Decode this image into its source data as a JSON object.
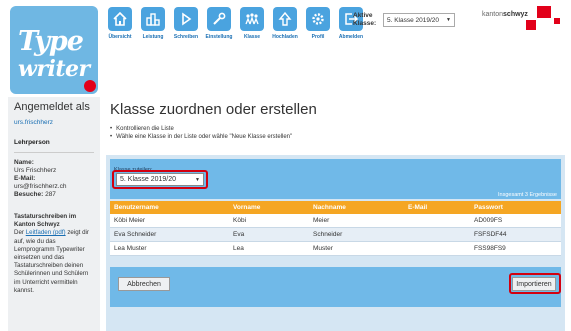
{
  "logo": {
    "line1": "Type",
    "line2": "writer"
  },
  "nav": [
    {
      "label": "Übersicht",
      "icon": "home-icon"
    },
    {
      "label": "Leistung",
      "icon": "chart-icon"
    },
    {
      "label": "Schreiben",
      "icon": "play-icon"
    },
    {
      "label": "Einstellung",
      "icon": "wrench-icon"
    },
    {
      "label": "Klasse",
      "icon": "group-icon"
    },
    {
      "label": "Hochladen",
      "icon": "upload-icon"
    },
    {
      "label": "Profil",
      "icon": "gear-icon"
    },
    {
      "label": "Abmelden",
      "icon": "logout-icon"
    }
  ],
  "active_class": {
    "label": "Aktive Klasse:",
    "value": "5. Klasse 2019/20"
  },
  "kanton": {
    "prefix": "kanton",
    "name": "schwyz"
  },
  "sidebar": {
    "title": "Angemeldet als",
    "user": "urs.frischherz",
    "role": "Lehrperson",
    "name_label": "Name:",
    "name": "Urs Frischherz",
    "email_label": "E-Mail:",
    "email": "urs@frischherz.ch",
    "visits_label": "Besuche:",
    "visits": "287",
    "desc_title": "Tastaturschreiben im Kanton Schwyz",
    "desc_pre": "Der ",
    "desc_link": "Leitfaden (pdf)",
    "desc_post": " zeigt dir auf, wie du das Lernprogramm Typewriter einsetzen und das Tastaturschreiben deinen Schülerinnen und Schülern im Unterricht vermitteln kannst."
  },
  "main": {
    "title": "Klasse zuordnen oder erstellen",
    "bullets": [
      "Kontrollieren die Liste",
      "Wähle eine Klasse in der Liste oder wähle \"Neue Klasse erstellen\""
    ],
    "assign_label": "Klasse zuteilen:",
    "assign_value": "5. Klasse 2019/20",
    "count": "Insgesamt 3 Ergebnisse",
    "columns": [
      "Benutzername",
      "Vorname",
      "Nachname",
      "E-Mail",
      "Passwort"
    ],
    "rows": [
      [
        "Köbi Meier",
        "Köbi",
        "Meier",
        "",
        "AD009FS"
      ],
      [
        "Eva Schneider",
        "Eva",
        "Schneider",
        "",
        "FSFSDF44"
      ],
      [
        "Lea Muster",
        "Lea",
        "Muster",
        "",
        "FSS98FS9"
      ]
    ],
    "cancel_label": "Abbrechen",
    "import_label": "Importieren"
  }
}
